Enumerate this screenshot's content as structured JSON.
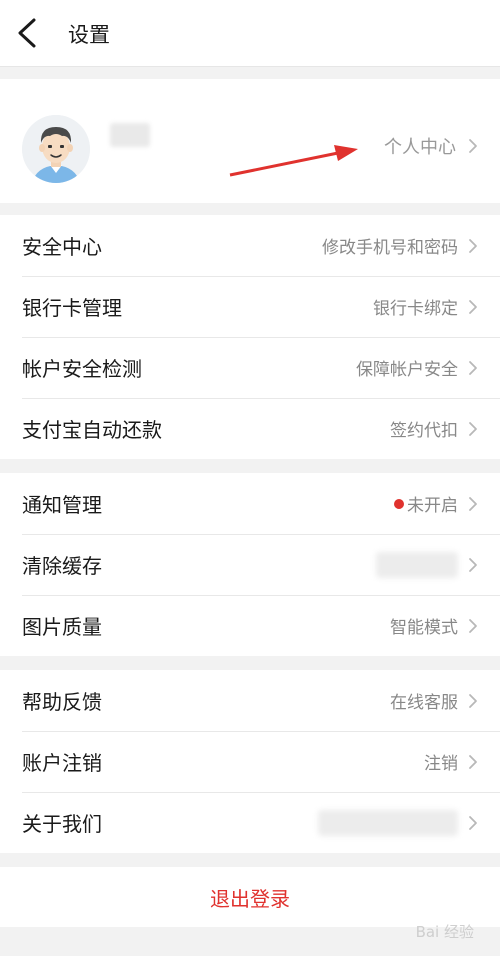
{
  "header": {
    "title": "设置",
    "back_icon": "chevron-left-icon"
  },
  "profile": {
    "username": "",
    "link_label": "个人中心",
    "avatar_icon": "avatar-boy-icon",
    "annotation_color": "#e0322e"
  },
  "groups": [
    {
      "items": [
        {
          "label": "安全中心",
          "value": "修改手机号和密码"
        },
        {
          "label": "银行卡管理",
          "value": "银行卡绑定"
        },
        {
          "label": "帐户安全检测",
          "value": "保障帐户安全"
        },
        {
          "label": "支付宝自动还款",
          "value": "签约代扣"
        }
      ]
    },
    {
      "items": [
        {
          "label": "通知管理",
          "value": "未开启",
          "status_dot": "#e0322e"
        },
        {
          "label": "清除缓存",
          "value": ""
        },
        {
          "label": "图片质量",
          "value": "智能模式"
        }
      ]
    },
    {
      "items": [
        {
          "label": "帮助反馈",
          "value": "在线客服"
        },
        {
          "label": "账户注销",
          "value": "注销"
        },
        {
          "label": "关于我们",
          "value": ""
        }
      ]
    }
  ],
  "logout": {
    "label": "退出登录"
  },
  "watermark": {
    "text": "Bai 经验"
  },
  "colors": {
    "accent": "#e0322e",
    "background": "#f2f2f2",
    "chevron": "#b8b8b8"
  }
}
